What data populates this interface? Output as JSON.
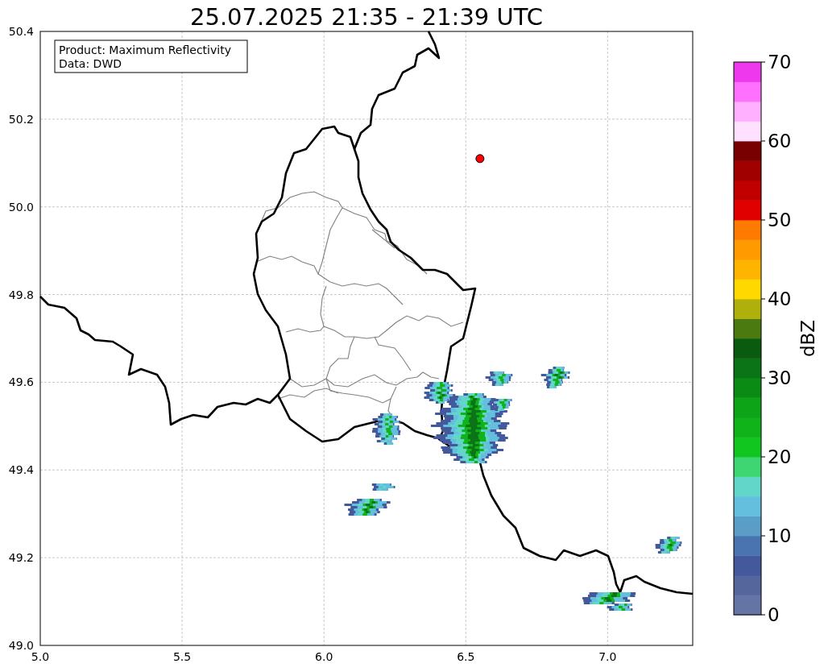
{
  "title": "25.07.2025 21:35 - 21:39 UTC",
  "info_box": {
    "lines": [
      "Product: Maximum Reflectivity",
      "Data: DWD"
    ]
  },
  "map": {
    "chart_data": {
      "type": "scatter",
      "x": [
        6.55
      ],
      "series": [
        {
          "color": "#ff0000",
          "values": [
            50.11
          ]
        }
      ],
      "grid": true,
      "xlim": [
        5.0,
        7.3
      ],
      "ylim": [
        49.0,
        50.4
      ],
      "xticks": [
        {
          "value": 5.0,
          "label": "5.0"
        },
        {
          "value": 5.5,
          "label": "5.5"
        },
        {
          "value": 6.0,
          "label": "6.0"
        },
        {
          "value": 6.5,
          "label": "6.5"
        },
        {
          "value": 7.0,
          "label": "7.0"
        }
      ],
      "yticks": [
        {
          "value": 49.0,
          "label": "49.0"
        },
        {
          "value": 49.2,
          "label": "49.2"
        },
        {
          "value": 49.4,
          "label": "49.4"
        },
        {
          "value": 49.6,
          "label": "49.6"
        },
        {
          "value": 49.8,
          "label": "49.8"
        },
        {
          "value": 50.0,
          "label": "50.0"
        },
        {
          "value": 50.2,
          "label": "50.2"
        },
        {
          "value": 50.4,
          "label": "50.4"
        }
      ]
    }
  },
  "colorbar": {
    "label": "dBZ",
    "ticks": [
      "70",
      "60",
      "50",
      "40",
      "30",
      "20",
      "10",
      "0"
    ],
    "bands": [
      {
        "color": "#6474a4"
      },
      {
        "color": "#54669c"
      },
      {
        "color": "#44589c"
      },
      {
        "color": "#4a74b0"
      },
      {
        "color": "#5a9ec8"
      },
      {
        "color": "#64bede"
      },
      {
        "color": "#62d6c8"
      },
      {
        "color": "#3ed672"
      },
      {
        "color": "#12c620"
      },
      {
        "color": "#10b41a"
      },
      {
        "color": "#0ea418"
      },
      {
        "color": "#0a8c14"
      },
      {
        "color": "#0a7416"
      },
      {
        "color": "#0a5a10"
      },
      {
        "color": "#4a7a10"
      },
      {
        "color": "#b0b00c"
      },
      {
        "color": "#ffd800"
      },
      {
        "color": "#ffb400"
      },
      {
        "color": "#ff9a00"
      },
      {
        "color": "#ff7a00"
      },
      {
        "color": "#e00000"
      },
      {
        "color": "#c00000"
      },
      {
        "color": "#a00000"
      },
      {
        "color": "#780000"
      },
      {
        "color": "#ffe0ff"
      },
      {
        "color": "#ffb0ff"
      },
      {
        "color": "#ff70ff"
      },
      {
        "color": "#ee38ee"
      }
    ]
  }
}
